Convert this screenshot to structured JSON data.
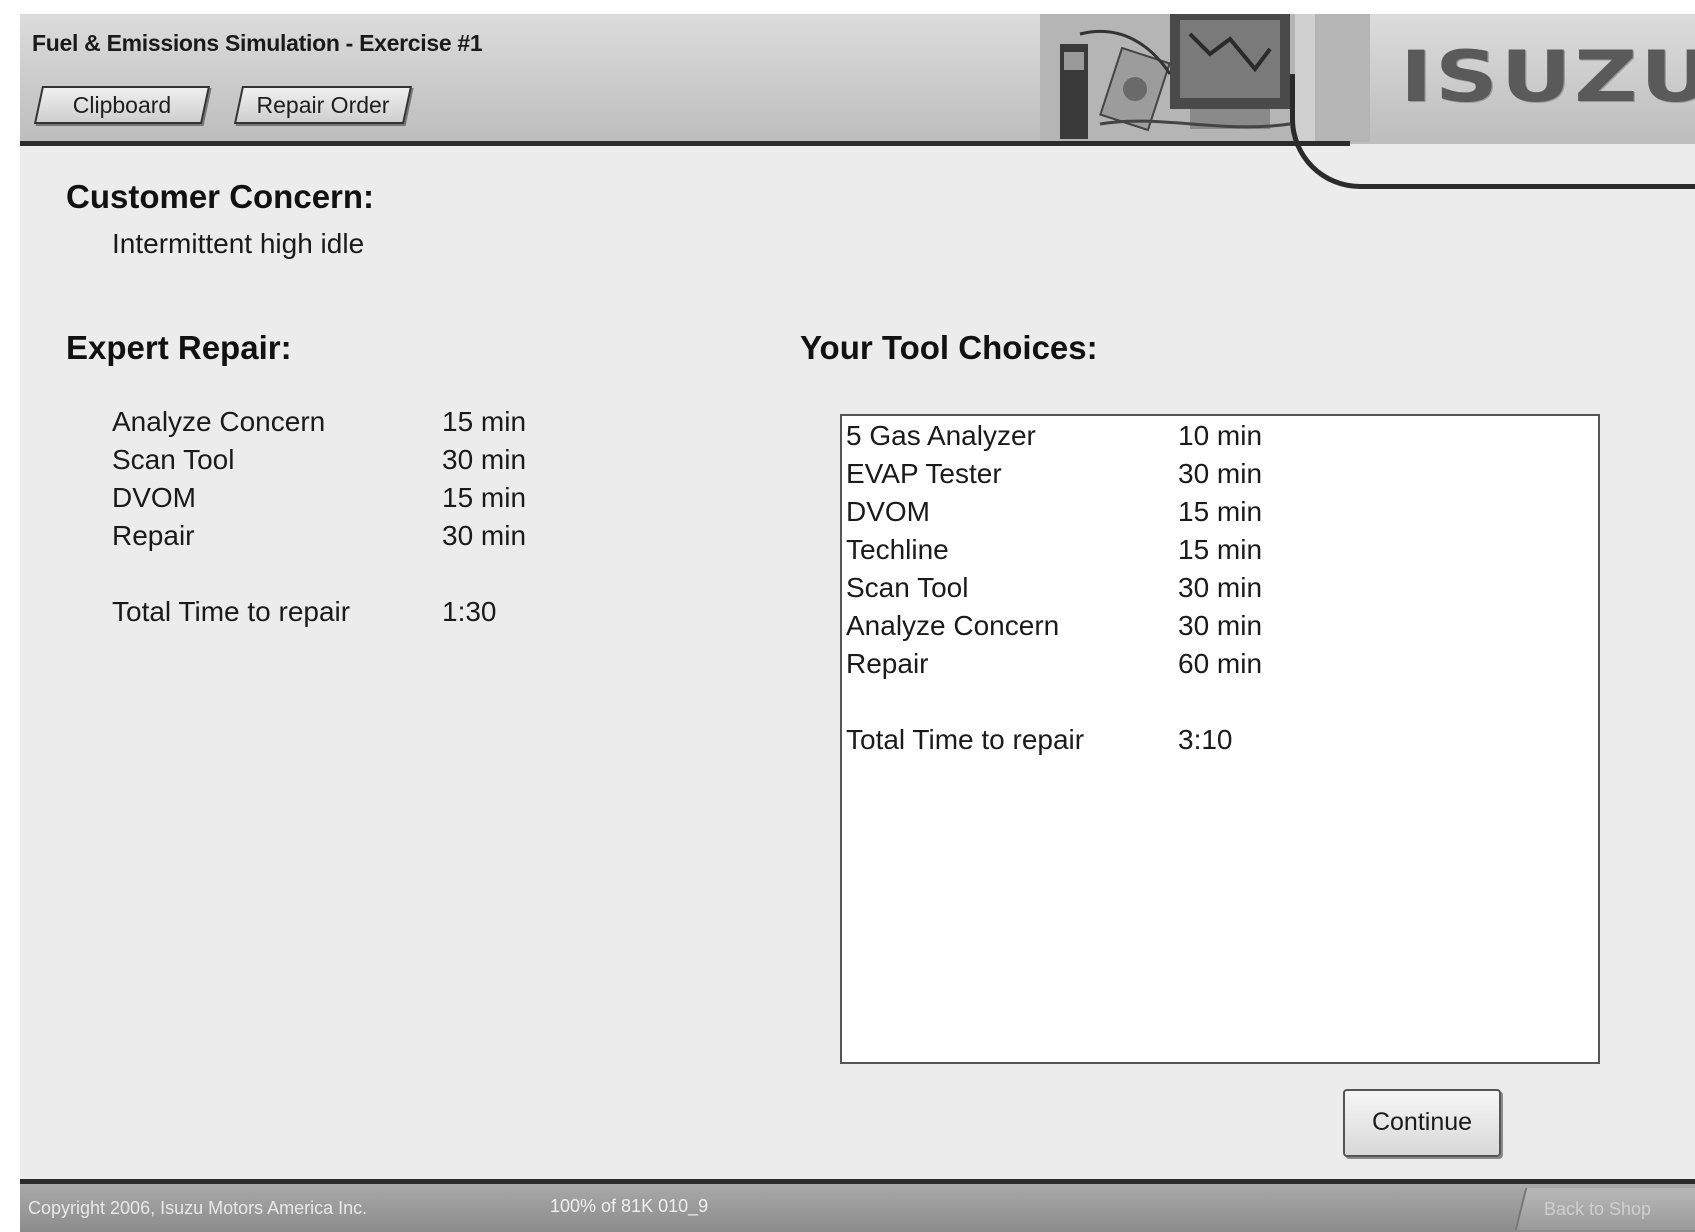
{
  "header": {
    "title": "Fuel & Emissions Simulation - Exercise #1",
    "tabs": [
      "Clipboard",
      "Repair Order"
    ],
    "logo_text": "ISUZU"
  },
  "customer_concern": {
    "heading": "Customer Concern:",
    "text": "Intermittent high idle"
  },
  "expert_repair": {
    "heading": "Expert Repair:",
    "items": [
      {
        "label": "Analyze Concern",
        "time": "15 min"
      },
      {
        "label": "Scan Tool",
        "time": "30 min"
      },
      {
        "label": "DVOM",
        "time": "15 min"
      },
      {
        "label": "Repair",
        "time": "30 min"
      }
    ],
    "total_label": "Total Time to repair",
    "total_value": "1:30"
  },
  "tool_choices": {
    "heading": "Your Tool Choices:",
    "items": [
      {
        "label": "5 Gas Analyzer",
        "time": "10 min"
      },
      {
        "label": "EVAP Tester",
        "time": "30 min"
      },
      {
        "label": "DVOM",
        "time": "15 min"
      },
      {
        "label": "Techline",
        "time": "15 min"
      },
      {
        "label": "Scan Tool",
        "time": "30 min"
      },
      {
        "label": "Analyze Concern",
        "time": "30 min"
      },
      {
        "label": "Repair",
        "time": "60 min"
      }
    ],
    "total_label": "Total Time to repair",
    "total_value": "3:10"
  },
  "continue_label": "Continue",
  "footer": {
    "copyright": "Copyright 2006, Isuzu Motors America Inc.",
    "status": "100% of 81K   010_9",
    "back_label": "Back to Shop"
  },
  "colors": {
    "background": "#ececec",
    "header": "#c9c9c9",
    "rule": "#2b2b2b",
    "footer": "#8c8c8c"
  }
}
